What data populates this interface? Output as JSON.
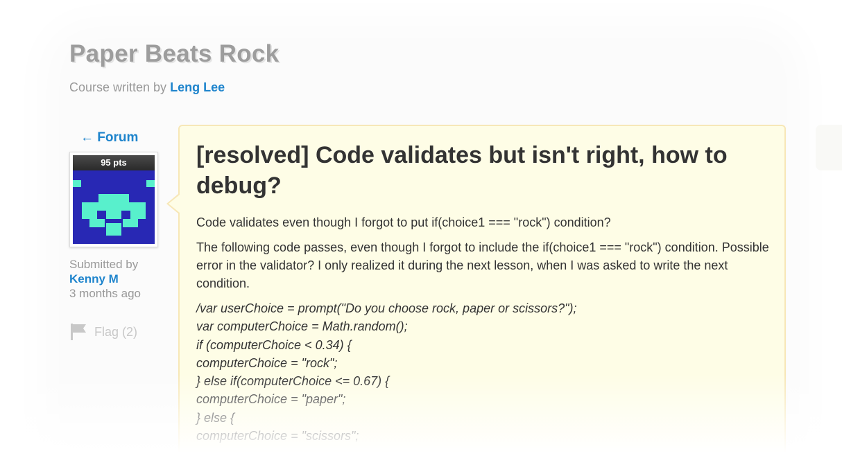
{
  "course": {
    "title": "Paper Beats Rock",
    "byline_prefix": "Course written by",
    "author": "Leng Lee"
  },
  "sidebar": {
    "back_link": "← Forum",
    "points": "95 pts",
    "submitted_label": "Submitted by",
    "submitter": "Kenny M",
    "time_ago": "3 months ago",
    "flag_label": "Flag (2)"
  },
  "post": {
    "title": "[resolved] Code validates but isn't right, how to debug?",
    "summary": "Code validates even though I forgot to put if(choice1 === \"rock\") condition?",
    "paragraph": "The following code passes, even though I forgot to include the if(choice1 === \"rock\") condition. Possible error in the validator? I only realized it during the next lesson, when I was asked to write the next condition.",
    "code_lines": [
      "/var userChoice = prompt(\"Do you choose rock, paper or scissors?\");",
      "var computerChoice = Math.random();",
      "if (computerChoice < 0.34) {",
      "computerChoice = \"rock\";",
      "} else if(computerChoice <= 0.67) {",
      "computerChoice = \"paper\";",
      "} else {",
      "computerChoice = \"scissors\";"
    ]
  },
  "colors": {
    "link": "#1e84cc",
    "post_background": "#fefde6",
    "post_border": "#f7e7b7",
    "avatar_background": "#2828b4",
    "avatar_pattern": "#58f0cc"
  }
}
